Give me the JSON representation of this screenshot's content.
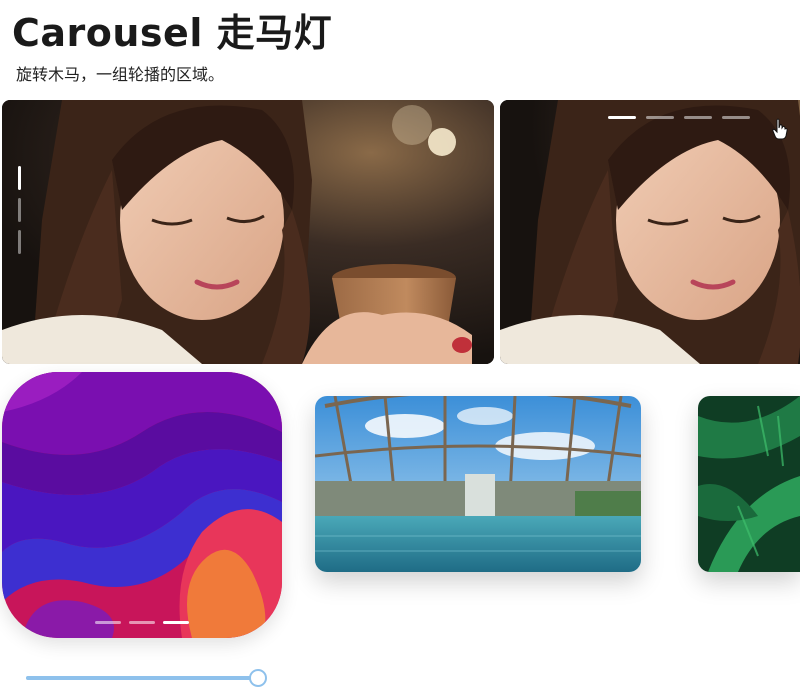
{
  "page": {
    "title": "Carousel 走马灯",
    "subtitle": "旋转木马，一组轮播的区域。"
  },
  "carousel_vertical": {
    "slide_count": 3,
    "active_index": 0,
    "image": "woman-with-coffee-photo"
  },
  "carousel_horizontal": {
    "slide_count": 4,
    "active_index": 0,
    "image": "woman-with-coffee-photo"
  },
  "card_carousel": {
    "cards": [
      {
        "image": "abstract-purple-wave-art",
        "indicator_count": 3,
        "active_indicator": 2
      },
      {
        "image": "anime-greenhouse-flooded-scene"
      },
      {
        "image": "green-fern-leaves"
      }
    ]
  },
  "slider": {
    "value_fraction": 1.0
  },
  "colors": {
    "slider_accent": "#8ec1ec",
    "slider_track": "#cfe3f7"
  }
}
